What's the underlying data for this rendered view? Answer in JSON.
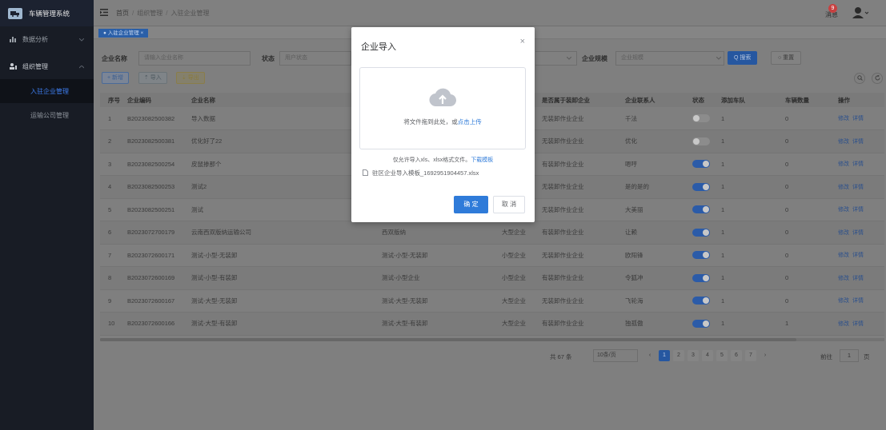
{
  "app": {
    "title": "车辆管理系统"
  },
  "sidebar": {
    "items": [
      {
        "label": "数据分析"
      },
      {
        "label": "组织管理"
      }
    ],
    "subitems": [
      {
        "label": "入驻企业管理"
      },
      {
        "label": "运输公司管理"
      }
    ]
  },
  "header": {
    "breadcrumb": [
      "首页",
      "组织管理",
      "入驻企业管理"
    ],
    "messages_label": "消息",
    "messages_count": "9"
  },
  "tags": {
    "active": "● 入驻企业管理 ×"
  },
  "filter": {
    "company_name_label": "企业名称",
    "company_name_placeholder": "请输入企业名称",
    "status_label": "状态",
    "status_placeholder": "用户状态",
    "scale_label": "企业规模",
    "scale_placeholder": "企业规模",
    "search_label": "Q 搜索",
    "reset_label": "○ 重置"
  },
  "toolbar": {
    "add_label": "+ 新增",
    "import_label": "⇡ 导入",
    "export_label": "⇣ 导出"
  },
  "table": {
    "headers": [
      "序号",
      "企业编码",
      "企业名称",
      "",
      "",
      "是否属于装卸企业",
      "企业联系人",
      "状态",
      "添加车队",
      "车辆数量",
      "操作"
    ],
    "rows": [
      {
        "idx": "1",
        "code": "B2023082500382",
        "name": "导入数据",
        "short": "",
        "size": "",
        "type": "无装卸作业企业",
        "contact": "千法",
        "status": "off",
        "fleet": "1",
        "vehicles": "0"
      },
      {
        "idx": "2",
        "code": "B2023082500381",
        "name": "优化好了22",
        "short": "",
        "size": "",
        "type": "无装卸作业企业",
        "contact": "优化",
        "status": "off",
        "fleet": "1",
        "vehicles": "0"
      },
      {
        "idx": "3",
        "code": "B2023082500254",
        "name": "皮鼠掺那个",
        "short": "",
        "size": "",
        "type": "有装卸作业企业",
        "contact": "嗯哼",
        "status": "on",
        "fleet": "1",
        "vehicles": "0"
      },
      {
        "idx": "4",
        "code": "B2023082500253",
        "name": "测试2",
        "short": "",
        "size": "",
        "type": "无装卸作业企业",
        "contact": "是的是的",
        "status": "on",
        "fleet": "1",
        "vehicles": "0"
      },
      {
        "idx": "5",
        "code": "B2023082500251",
        "name": "测试",
        "short": "",
        "size": "",
        "type": "无装卸作业企业",
        "contact": "大美丽",
        "status": "on",
        "fleet": "1",
        "vehicles": "0"
      },
      {
        "idx": "6",
        "code": "B2023072700179",
        "name": "云南西双版纳运输公司",
        "short": "西双版纳",
        "size": "大型企业",
        "type": "有装卸作业企业",
        "contact": "让赖",
        "status": "on",
        "fleet": "1",
        "vehicles": "0"
      },
      {
        "idx": "7",
        "code": "B2023072600171",
        "name": "测试-小型-无装卸",
        "short": "测试-小型-无装卸",
        "size": "小型企业",
        "type": "无装卸作业企业",
        "contact": "欧阳锋",
        "status": "on",
        "fleet": "1",
        "vehicles": "0"
      },
      {
        "idx": "8",
        "code": "B2023072600169",
        "name": "测试-小型-有装卸",
        "short": "测试-小型企业",
        "size": "小型企业",
        "type": "有装卸作业企业",
        "contact": "令狐冲",
        "status": "on",
        "fleet": "1",
        "vehicles": "0"
      },
      {
        "idx": "9",
        "code": "B2023072600167",
        "name": "测试-大型-无装卸",
        "short": "测试-大型-无装卸",
        "size": "大型企业",
        "type": "无装卸作业企业",
        "contact": "飞轮海",
        "status": "on",
        "fleet": "1",
        "vehicles": "0"
      },
      {
        "idx": "10",
        "code": "B2023072600166",
        "name": "测试-大型-有装卸",
        "short": "测试-大型-有装卸",
        "size": "大型企业",
        "type": "有装卸作业企业",
        "contact": "独孤傲",
        "status": "on",
        "fleet": "1",
        "vehicles": "1"
      }
    ],
    "edit_label": "修改",
    "detail_label": "详情"
  },
  "pagination": {
    "total": "共 67 条",
    "page_size": "10条/页",
    "pages": [
      "1",
      "2",
      "3",
      "4",
      "5",
      "6",
      "7"
    ],
    "current": "1",
    "goto_label": "前往",
    "goto_value": "1",
    "page_suffix": "页"
  },
  "modal": {
    "title": "企业导入",
    "drop_text": "将文件拖到此处，或",
    "click_upload": "点击上传",
    "tip_text": "仅允许导入xls、xlsx格式文件。",
    "template_link": "下载模板",
    "file_name": "驻区企业导入模板_1692951904457.xlsx",
    "confirm_label": "确 定",
    "cancel_label": "取 消"
  },
  "colors": {
    "primary": "#2f7bd9",
    "sidebar_bg": "#181c25",
    "badge": "#c84040"
  }
}
